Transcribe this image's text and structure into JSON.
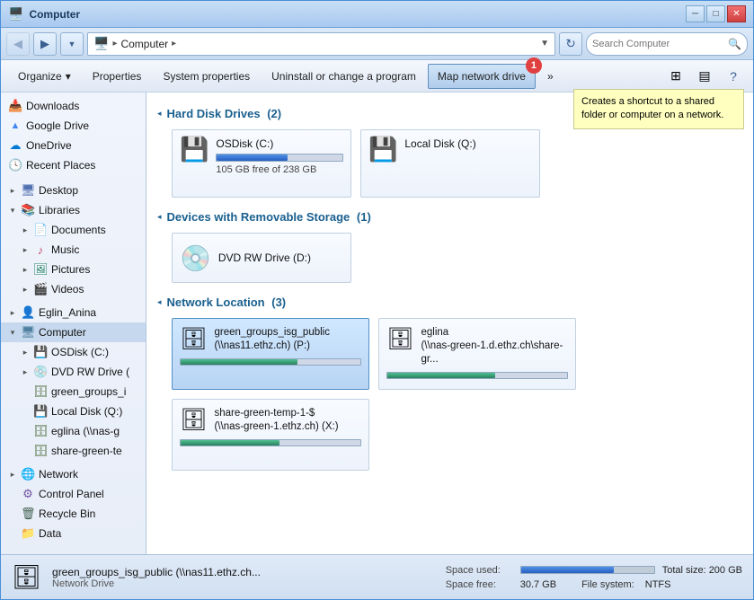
{
  "window": {
    "title": "Computer",
    "title_icon": "🖥️"
  },
  "titlebar": {
    "minimize_label": "─",
    "maximize_label": "□",
    "close_label": "✕"
  },
  "navbar": {
    "back_title": "Back",
    "forward_title": "Forward",
    "recent_title": "Recent",
    "refresh_title": "Refresh",
    "address": {
      "icon": "🖥️",
      "path": "Computer",
      "arrow": "▸"
    },
    "search_placeholder": "Search Computer"
  },
  "toolbar": {
    "organize_label": "Organize",
    "organize_arrow": "▾",
    "properties_label": "Properties",
    "system_properties_label": "System properties",
    "uninstall_label": "Uninstall or change a program",
    "map_network_label": "Map network drive",
    "more_label": "»"
  },
  "tooltip": {
    "text": "Creates a shortcut to a shared folder or computer on a network."
  },
  "map_badge": "1",
  "sidebar": {
    "items": [
      {
        "id": "downloads",
        "label": "Downloads",
        "icon": "📥",
        "level": 1,
        "expanded": false
      },
      {
        "id": "google-drive",
        "label": "Google Drive",
        "icon": "▲",
        "level": 1,
        "expanded": false
      },
      {
        "id": "onedrive",
        "label": "OneDrive",
        "icon": "☁",
        "level": 1,
        "expanded": false
      },
      {
        "id": "recent-places",
        "label": "Recent Places",
        "icon": "🕓",
        "level": 1,
        "expanded": false
      },
      {
        "id": "desktop",
        "label": "Desktop",
        "icon": "🖥",
        "level": 1,
        "expanded": true,
        "expander": "▸"
      },
      {
        "id": "libraries",
        "label": "Libraries",
        "icon": "📚",
        "level": 1,
        "expanded": true,
        "expander": "▾"
      },
      {
        "id": "documents",
        "label": "Documents",
        "icon": "📄",
        "level": 2,
        "expanded": false,
        "expander": "▸"
      },
      {
        "id": "music",
        "label": "Music",
        "icon": "♪",
        "level": 2,
        "expanded": false,
        "expander": "▸"
      },
      {
        "id": "pictures",
        "label": "Pictures",
        "icon": "🖼",
        "level": 2,
        "expanded": false,
        "expander": "▸"
      },
      {
        "id": "videos",
        "label": "Videos",
        "icon": "🎬",
        "level": 2,
        "expanded": false,
        "expander": "▸"
      },
      {
        "id": "eglin-anina",
        "label": "Eglin_Anina",
        "icon": "👤",
        "level": 1,
        "expanded": true,
        "expander": "▸"
      },
      {
        "id": "computer",
        "label": "Computer",
        "icon": "🖥",
        "level": 1,
        "expanded": true,
        "expander": "▾",
        "selected": true
      },
      {
        "id": "osdisk",
        "label": "OSDisk (C:)",
        "icon": "💾",
        "level": 2,
        "expanded": false,
        "expander": "▸"
      },
      {
        "id": "dvd-rw",
        "label": "DVD RW Drive (",
        "icon": "💿",
        "level": 2,
        "expanded": false,
        "expander": "▸"
      },
      {
        "id": "green-groups",
        "label": "green_groups_i",
        "icon": "🗄",
        "level": 2,
        "expanded": false
      },
      {
        "id": "local-disk",
        "label": "Local Disk (Q:)",
        "icon": "💾",
        "level": 2,
        "expanded": false
      },
      {
        "id": "eglina-nas",
        "label": "eglina (\\\\nas-g",
        "icon": "🗄",
        "level": 2,
        "expanded": false
      },
      {
        "id": "share-green",
        "label": "share-green-te",
        "icon": "🗄",
        "level": 2,
        "expanded": false
      },
      {
        "id": "network",
        "label": "Network",
        "icon": "🌐",
        "level": 1,
        "expanded": false,
        "expander": "▸"
      },
      {
        "id": "control-panel",
        "label": "Control Panel",
        "icon": "⚙",
        "level": 1,
        "expanded": false
      },
      {
        "id": "recycle-bin",
        "label": "Recycle Bin",
        "icon": "🗑",
        "level": 1,
        "expanded": false
      },
      {
        "id": "data",
        "label": "Data",
        "icon": "📁",
        "level": 1,
        "expanded": false
      }
    ]
  },
  "content": {
    "hard_disk": {
      "title": "Hard Disk Drives",
      "count": "(2)",
      "drives": [
        {
          "id": "osdisk-c",
          "name": "OSDisk (C:)",
          "free": "105 GB free of 238 GB",
          "used_percent": 56,
          "icon": "💾"
        },
        {
          "id": "local-q",
          "name": "Local Disk (Q:)",
          "free": "",
          "used_percent": 0,
          "icon": "💾"
        }
      ]
    },
    "removable": {
      "title": "Devices with Removable Storage",
      "count": "(1)",
      "drives": [
        {
          "id": "dvd-d",
          "name": "DVD RW Drive (D:)",
          "icon": "💿"
        }
      ]
    },
    "network": {
      "title": "Network Location",
      "count": "(3)",
      "drives": [
        {
          "id": "green-groups-p",
          "name": "green_groups_isg_public",
          "path": "(\\\\nas11.ethz.ch) (P:)",
          "used_percent": 65,
          "selected": true
        },
        {
          "id": "eglina-nas",
          "name": "eglina",
          "path": "(\\\\nas-green-1.d.ethz.ch\\share-gr...",
          "used_percent": 60,
          "selected": false
        },
        {
          "id": "share-green-x",
          "name": "share-green-temp-1-$",
          "path": "(\\\\nas-green-1.ethz.ch) (X:)",
          "used_percent": 55,
          "selected": false
        }
      ]
    }
  },
  "statusbar": {
    "drive_icon": "🗄",
    "name": "green_groups_isg_public (\\\\nas11.ethz.ch...",
    "type": "Network Drive",
    "space_used_label": "Space used:",
    "space_used_percent": 70,
    "space_free_label": "Space free:",
    "space_free_value": "30.7 GB",
    "total_size_label": "Total size:",
    "total_size_value": "200 GB",
    "filesystem_label": "File system:",
    "filesystem_value": "NTFS"
  }
}
